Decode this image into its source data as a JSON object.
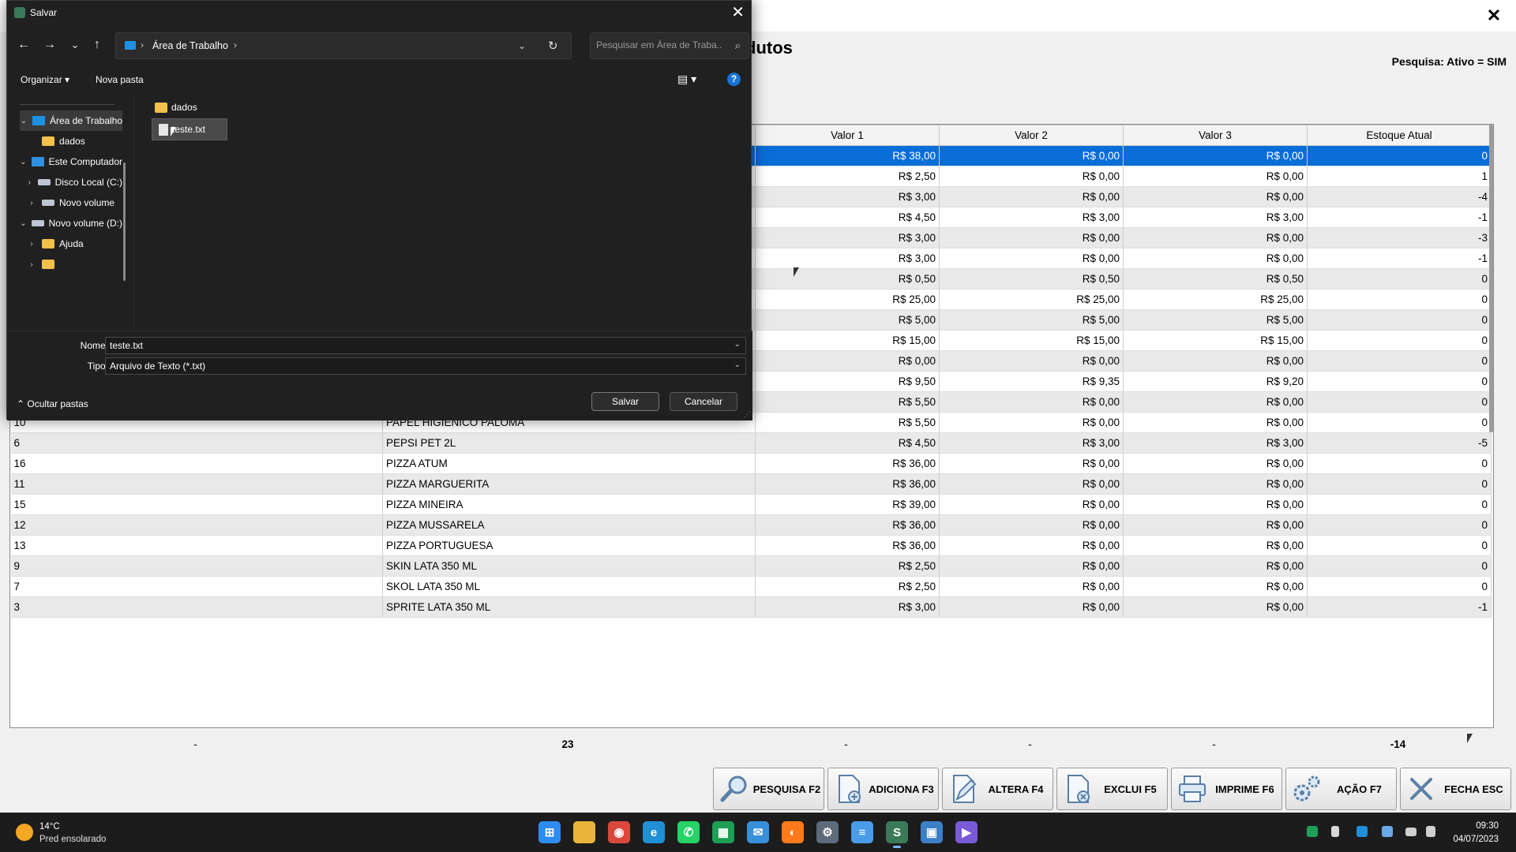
{
  "app": {
    "title": "dutos",
    "close_glyph": "✕",
    "search_status": "Pesquisa: Ativo = SIM",
    "grid": {
      "columns": [
        "",
        "",
        "Valor 1",
        "Valor 2",
        "Valor 3",
        "Estoque Atual"
      ],
      "rows": [
        {
          "code": "",
          "name": "",
          "v1": "R$ 38,00",
          "v2": "R$ 0,00",
          "v3": "R$ 0,00",
          "stock": "0",
          "selected": true
        },
        {
          "code": "",
          "name": "",
          "v1": "R$ 2,50",
          "v2": "R$ 0,00",
          "v3": "R$ 0,00",
          "stock": "1"
        },
        {
          "code": "",
          "name": "",
          "v1": "R$ 3,00",
          "v2": "R$ 0,00",
          "v3": "R$ 0,00",
          "stock": "-4"
        },
        {
          "code": "",
          "name": "",
          "v1": "R$ 4,50",
          "v2": "R$ 3,00",
          "v3": "R$ 3,00",
          "stock": "-1"
        },
        {
          "code": "",
          "name": "",
          "v1": "R$ 3,00",
          "v2": "R$ 0,00",
          "v3": "R$ 0,00",
          "stock": "-3"
        },
        {
          "code": "",
          "name": "",
          "v1": "R$ 3,00",
          "v2": "R$ 0,00",
          "v3": "R$ 0,00",
          "stock": "-1"
        },
        {
          "code": "",
          "name": "",
          "v1": "R$ 0,50",
          "v2": "R$ 0,50",
          "v3": "R$ 0,50",
          "stock": "0"
        },
        {
          "code": "",
          "name": "",
          "v1": "R$ 25,00",
          "v2": "R$ 25,00",
          "v3": "R$ 25,00",
          "stock": "0"
        },
        {
          "code": "",
          "name": "",
          "v1": "R$ 5,00",
          "v2": "R$ 5,00",
          "v3": "R$ 5,00",
          "stock": "0"
        },
        {
          "code": "",
          "name": "",
          "v1": "R$ 15,00",
          "v2": "R$ 15,00",
          "v3": "R$ 15,00",
          "stock": "0"
        },
        {
          "code": "",
          "name": "",
          "v1": "R$ 0,00",
          "v2": "R$ 0,00",
          "v3": "R$ 0,00",
          "stock": "0"
        },
        {
          "code": "",
          "name": "",
          "v1": "R$ 9,50",
          "v2": "R$ 9,35",
          "v3": "R$ 9,20",
          "stock": "0"
        },
        {
          "code": "",
          "name": "",
          "v1": "R$ 5,50",
          "v2": "R$ 0,00",
          "v3": "R$ 0,00",
          "stock": "0"
        },
        {
          "code": "10",
          "name": "PAPEL HIGIENICO PALOMA",
          "v1": "R$ 5,50",
          "v2": "R$ 0,00",
          "v3": "R$ 0,00",
          "stock": "0"
        },
        {
          "code": "6",
          "name": "PEPSI PET 2L",
          "v1": "R$ 4,50",
          "v2": "R$ 3,00",
          "v3": "R$ 3,00",
          "stock": "-5"
        },
        {
          "code": "16",
          "name": "PIZZA ATUM",
          "v1": "R$ 36,00",
          "v2": "R$ 0,00",
          "v3": "R$ 0,00",
          "stock": "0"
        },
        {
          "code": "11",
          "name": "PIZZA MARGUERITA",
          "v1": "R$ 36,00",
          "v2": "R$ 0,00",
          "v3": "R$ 0,00",
          "stock": "0"
        },
        {
          "code": "15",
          "name": "PIZZA MINEIRA",
          "v1": "R$ 39,00",
          "v2": "R$ 0,00",
          "v3": "R$ 0,00",
          "stock": "0"
        },
        {
          "code": "12",
          "name": "PIZZA MUSSARELA",
          "v1": "R$ 36,00",
          "v2": "R$ 0,00",
          "v3": "R$ 0,00",
          "stock": "0"
        },
        {
          "code": "13",
          "name": "PIZZA PORTUGUESA",
          "v1": "R$ 36,00",
          "v2": "R$ 0,00",
          "v3": "R$ 0,00",
          "stock": "0"
        },
        {
          "code": "9",
          "name": "SKIN LATA 350 ML",
          "v1": "R$ 2,50",
          "v2": "R$ 0,00",
          "v3": "R$ 0,00",
          "stock": "0"
        },
        {
          "code": "7",
          "name": "SKOL LATA 350 ML",
          "v1": "R$ 2,50",
          "v2": "R$ 0,00",
          "v3": "R$ 0,00",
          "stock": "0"
        },
        {
          "code": "3",
          "name": "SPRITE LATA 350 ML",
          "v1": "R$ 3,00",
          "v2": "R$ 0,00",
          "v3": "R$ 0,00",
          "stock": "-1"
        }
      ]
    },
    "totals": [
      "-",
      "23",
      "-",
      "-",
      "-",
      "-14"
    ],
    "toolbar": [
      {
        "label": "PESQUISA F2",
        "icon": "magnifier-icon"
      },
      {
        "label": "ADICIONA F3",
        "icon": "add-document-icon"
      },
      {
        "label": "ALTERA F4",
        "icon": "edit-document-icon"
      },
      {
        "label": "EXCLUI F5",
        "icon": "delete-document-icon"
      },
      {
        "label": "IMPRIME F6",
        "icon": "printer-icon"
      },
      {
        "label": "AÇÃO F7",
        "icon": "gears-icon"
      },
      {
        "label": "FECHA ESC",
        "icon": "close-x-icon"
      }
    ]
  },
  "dialog": {
    "title": "Salvar",
    "close_glyph": "✕",
    "nav": {
      "back": "←",
      "forward": "→",
      "recent": "⌄",
      "up": "↑",
      "refresh": "↻"
    },
    "address": {
      "sep": "›",
      "location": "Área de Trabalho",
      "dropdown": "⌄"
    },
    "search": {
      "placeholder": "Pesquisar em Área de Traba...",
      "icon": "⌕"
    },
    "commands": {
      "organize": "Organizar ▾",
      "new_folder": "Nova pasta",
      "view": "▤ ▾",
      "help": "?"
    },
    "nav_pane": [
      {
        "label": "Área de Trabalho",
        "chev": "⌄",
        "icon": "desk",
        "level": 0,
        "selected": true
      },
      {
        "label": "dados",
        "chev": "",
        "icon": "folder",
        "level": 1
      },
      {
        "label": "Este Computador",
        "chev": "⌄",
        "icon": "pc",
        "level": 0
      },
      {
        "label": "Disco Local (C:)",
        "chev": "›",
        "icon": "drive",
        "level": 1
      },
      {
        "label": "Novo volume",
        "chev": "›",
        "icon": "drive",
        "level": 1
      },
      {
        "label": "Novo volume (D:)",
        "chev": "⌄",
        "icon": "drive",
        "level": 0
      },
      {
        "label": "Ajuda",
        "chev": "›",
        "icon": "folder",
        "level": 1
      },
      {
        "label": "",
        "chev": "›",
        "icon": "folder",
        "level": 1
      }
    ],
    "files": [
      {
        "name": "dados",
        "type": "folder"
      },
      {
        "name": "teste.txt",
        "type": "file",
        "selected": true
      }
    ],
    "filename": {
      "label": "Nome:",
      "value": "teste.txt"
    },
    "filetype": {
      "label": "Tipo:",
      "value": "Arquivo de Texto (*.txt)"
    },
    "hide_folders": "⌃  Ocultar pastas",
    "save_button": "Salvar",
    "cancel_button": "Cancelar"
  },
  "taskbar": {
    "weather_temp": "14°C",
    "weather_desc": "Pred ensolarado",
    "apps": [
      {
        "name": "windows-start-icon",
        "color": "#2d8cf0",
        "glyph": "⊞"
      },
      {
        "name": "file-explorer-icon",
        "color": "#e8b43a",
        "glyph": ""
      },
      {
        "name": "chrome-icon",
        "color": "#d9493b",
        "glyph": "◉"
      },
      {
        "name": "edge-icon",
        "color": "#1f8fd6",
        "glyph": "e"
      },
      {
        "name": "whatsapp-icon",
        "color": "#25d366",
        "glyph": "✆"
      },
      {
        "name": "spreadsheet-icon",
        "color": "#1f9e56",
        "glyph": "▦"
      },
      {
        "name": "mail-icon",
        "color": "#3a8fd9",
        "glyph": "✉"
      },
      {
        "name": "firefox-icon",
        "color": "#ff7a1a",
        "glyph": "◐"
      },
      {
        "name": "settings-icon",
        "color": "#5d6b7a",
        "glyph": "⚙"
      },
      {
        "name": "notepad-icon",
        "color": "#4a9be8",
        "glyph": "≡"
      },
      {
        "name": "app-active-icon",
        "color": "#3b7a59",
        "glyph": "S",
        "active": true
      },
      {
        "name": "remote-desktop-icon",
        "color": "#3c80c8",
        "glyph": "▣"
      },
      {
        "name": "media-icon",
        "color": "#7a5ad6",
        "glyph": "▶"
      }
    ],
    "time": "09:30",
    "date": "04/07/2023"
  }
}
